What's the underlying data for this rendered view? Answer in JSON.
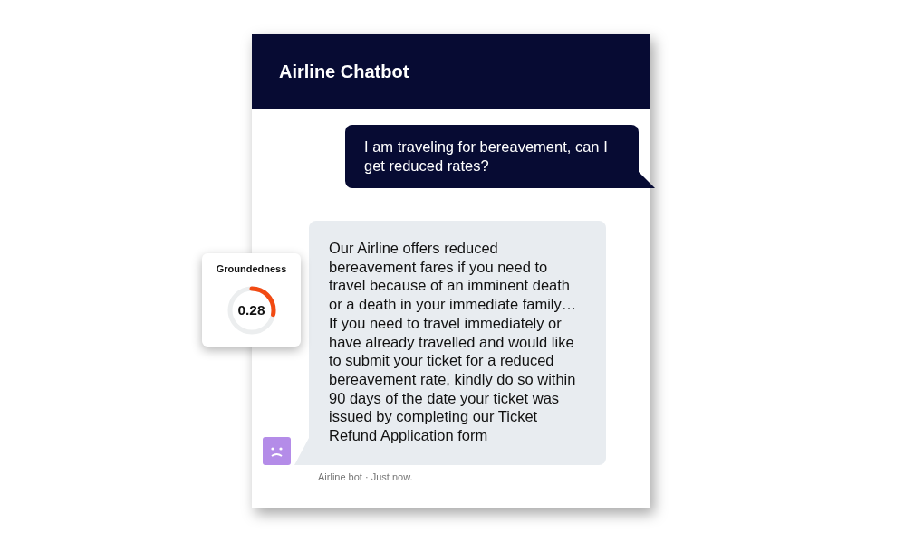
{
  "window": {
    "title": "Airline Chatbot"
  },
  "messages": [
    {
      "kind": "user",
      "text": "I am traveling for bereavement, can I get reduced rates?"
    },
    {
      "kind": "bot",
      "text": "Our Airline offers reduced bereavement fares if you need to travel because of an imminent death or a death in your immediate family… If you need to travel immediately or have already travelled and would like to submit your ticket for a reduced bereavement rate, kindly do so within 90 days of the date your ticket was issued by completing our Ticket Refund Application form",
      "meta": "Airline bot · Just now."
    }
  ],
  "score_card": {
    "title": "Groundedness",
    "value": "0.28",
    "level": 0.28
  }
}
